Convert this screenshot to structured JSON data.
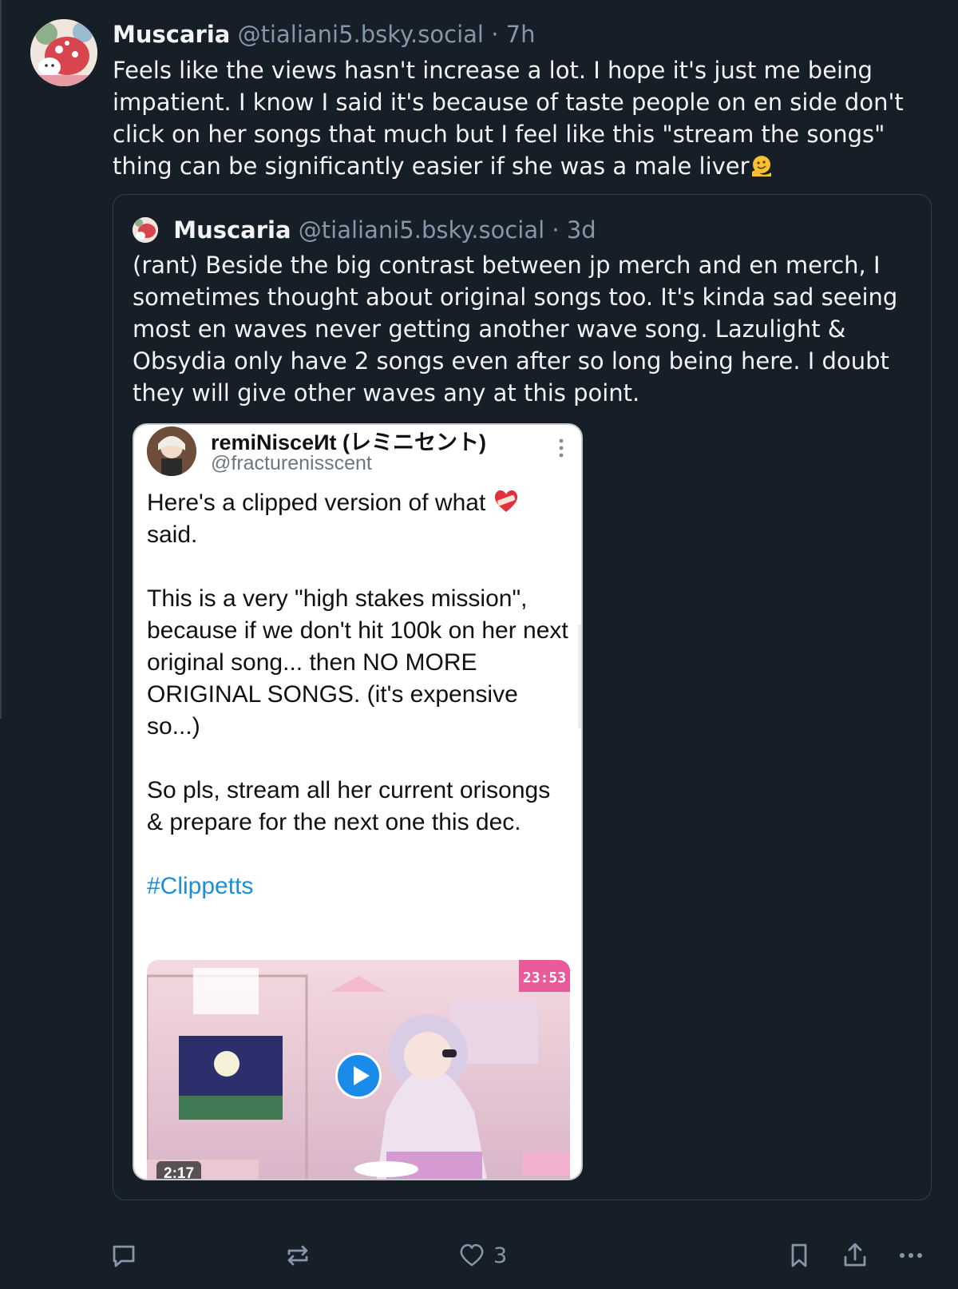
{
  "post": {
    "author_name": "Muscaria",
    "handle": "@tialiani5.bsky.social",
    "separator": "·",
    "time": "7h",
    "text": "Feels like the views hasn't increase a lot. I hope it's just me being impatient. I know I said it's because of taste people on en side don't click on her songs that much but I feel like this \"stream the songs\" thing can be significantly easier if she was a male liver",
    "trailing_emoji": "melting-face-emoji"
  },
  "quote": {
    "author_name": "Muscaria",
    "handle": "@tialiani5.bsky.social",
    "separator": "·",
    "time": "3d",
    "text": "(rant) Beside the big contrast between jp merch and en merch, I sometimes thought about original songs too. It's kinda sad seeing most en waves never getting another wave song. Lazulight & Obsydia only have 2 songs even after so long being here. I doubt they will give other waves any at this point."
  },
  "embedded_tweet": {
    "display_name": "remiNisceИt (レミニセント)",
    "handle": "@fracturenisscent",
    "line1_before_emoji": "Here's a clipped version of what ",
    "line1_after_emoji": "\nsaid.",
    "emoji": "mending-heart-emoji",
    "paragraph2": "This is a very \"high stakes mission\", because if we don't hit 100k on her next original song... then NO MORE ORIGINAL SONGS. (it's expensive so...)",
    "paragraph3": "So pls, stream all her current orisongs & prepare for the next one this dec.",
    "hashtag": "#Clippetts",
    "video_duration": "2:17",
    "video_clock": "23:53",
    "play_icon": "play-icon"
  },
  "actions": {
    "reply_icon": "reply-icon",
    "repost_icon": "repost-icon",
    "like_icon": "heart-icon",
    "like_count": "3",
    "bookmark_icon": "bookmark-icon",
    "share_icon": "share-icon",
    "more_icon": "more-icon"
  },
  "colors": {
    "background": "#161e27",
    "muted": "#8796a8",
    "border": "#2e4052",
    "hashtag": "#1d8fd3"
  }
}
